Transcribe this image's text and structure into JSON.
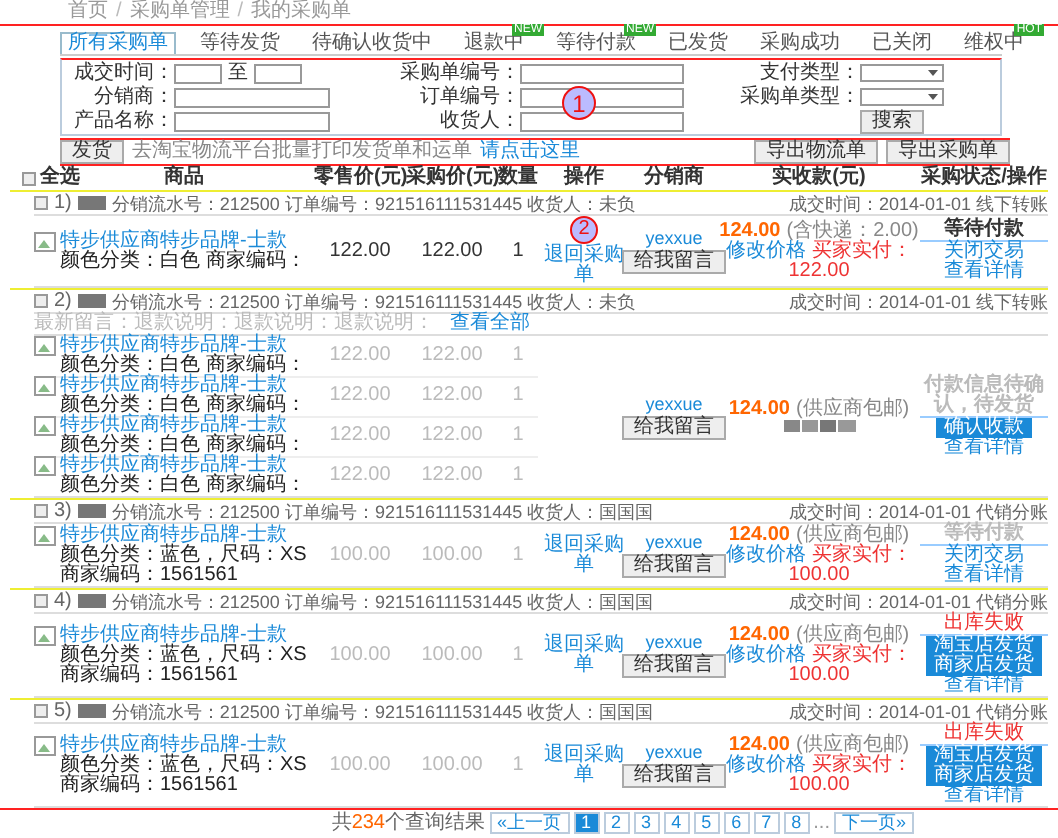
{
  "breadcrumb": {
    "separator": "/",
    "items": [
      "首页",
      "采购单管理",
      "我的采购单"
    ]
  },
  "tabs": [
    {
      "label": "所有采购单",
      "selected": true
    },
    {
      "label": "等待发货",
      "selected": false
    },
    {
      "label": "待确认收货中",
      "selected": false
    },
    {
      "label": "退款中",
      "selected": false,
      "badge": "NEW"
    },
    {
      "label": "等待付款",
      "selected": false,
      "badge": "NEW"
    },
    {
      "label": "已发货",
      "selected": false
    },
    {
      "label": "采购成功",
      "selected": false
    },
    {
      "label": "已关闭",
      "selected": false
    },
    {
      "label": "维权中",
      "selected": false,
      "badge": "HOT"
    }
  ],
  "filter": {
    "marker": "1",
    "date_label": "成交时间：",
    "date_to": "至",
    "distributor_label": "分销商：",
    "product_label": "产品名称：",
    "po_label": "采购单编号：",
    "order_label": "订单编号：",
    "receiver_label": "收货人：",
    "pay_type_label": "支付类型：",
    "po_type_label": "采购单类型：",
    "search_button": "搜索"
  },
  "toolbar": {
    "ship_button": "发货",
    "hint": "去淘宝物流平台批量打印发货单和运单",
    "hint_link": "请点击这里",
    "export_buttons": [
      "导出物流单",
      "导出采购单"
    ]
  },
  "columns": [
    "全选",
    "商品",
    "零售价(元)",
    "采购价(元)",
    "数量",
    "操作",
    "分销商",
    "实收款(元)",
    "采购状态/操作"
  ],
  "select_all_checked": false,
  "orders": [
    {
      "index": "1)",
      "checked": false,
      "info": "分销流水号：212500 订单编号：921516111531445 收货人：未负",
      "time": "成交时间：2014-01-01 线下转账",
      "marker": "2",
      "operation": "退回采购单",
      "distributor": "yexxue",
      "message_button": "给我留言",
      "items": [
        {
          "name": "特步供应商特步品牌-士款",
          "spec": "颜色分类：白色",
          "code": "商家编码：",
          "retail": "122.00",
          "purchase": "122.00",
          "qty": "1"
        }
      ],
      "amount": [
        {
          "kind": "total",
          "text": "124.00"
        },
        {
          "kind": "note",
          "text": "(含快递：2.00)"
        },
        {
          "kind": "link",
          "text": "修改价格"
        },
        {
          "kind": "paid",
          "text": "买家实付："
        },
        {
          "kind": "paid",
          "text": "122.00"
        }
      ],
      "status": [
        {
          "kind": "text",
          "text": "等待付款"
        },
        {
          "kind": "link",
          "text": "关闭交易"
        },
        {
          "kind": "link",
          "text": "查看详情"
        }
      ]
    },
    {
      "index": "2)",
      "checked": false,
      "info": "分销流水号：212500 订单编号：921516111531445 收货人：未负",
      "time": "成交时间：2014-01-01 线下转账",
      "message": "最新留言：退款说明：退款说明：退款说明：",
      "message_link": "查看全部",
      "distributor": "yexxue",
      "message_button": "给我留言",
      "items": [
        {
          "name": "特步供应商特步品牌-士款",
          "spec": "颜色分类：白色",
          "code": "商家编码：",
          "retail": "122.00",
          "purchase": "122.00",
          "qty": "1"
        },
        {
          "name": "特步供应商特步品牌-士款",
          "spec": "颜色分类：白色",
          "code": "商家编码：",
          "retail": "122.00",
          "purchase": "122.00",
          "qty": "1"
        },
        {
          "name": "特步供应商特步品牌-士款",
          "spec": "颜色分类：白色",
          "code": "商家编码：",
          "retail": "122.00",
          "purchase": "122.00",
          "qty": "1"
        },
        {
          "name": "特步供应商特步品牌-士款",
          "spec": "颜色分类：白色",
          "code": "商家编码：",
          "retail": "122.00",
          "purchase": "122.00",
          "qty": "1"
        }
      ],
      "amount": [
        {
          "kind": "total",
          "text": "124.00"
        },
        {
          "kind": "note",
          "text": "(供应商包邮)"
        },
        {
          "kind": "icons"
        }
      ],
      "status": [
        {
          "kind": "text",
          "text": "付款信息待确认，待发货"
        },
        {
          "kind": "button",
          "text": "确认收款"
        },
        {
          "kind": "link",
          "text": "查看详情"
        }
      ]
    },
    {
      "index": "3)",
      "checked": false,
      "info": "分销流水号：212500 订单编号：921516111531445 收货人：国国国",
      "time": "成交时间：2014-01-01 代销分账",
      "operation": "退回采购单",
      "distributor": "yexxue",
      "message_button": "给我留言",
      "items": [
        {
          "name": "特步供应商特步品牌-士款",
          "spec": "颜色分类：蓝色，尺码：XS",
          "code": "商家编码：1561561",
          "retail": "100.00",
          "purchase": "100.00",
          "qty": "1"
        }
      ],
      "amount": [
        {
          "kind": "total",
          "text": "124.00"
        },
        {
          "kind": "note",
          "text": "(供应商包邮)"
        },
        {
          "kind": "link",
          "text": "修改价格"
        },
        {
          "kind": "paid",
          "text": "买家实付："
        },
        {
          "kind": "paid",
          "text": "100.00"
        }
      ],
      "status": [
        {
          "kind": "text",
          "text": "等待付款"
        },
        {
          "kind": "link",
          "text": "关闭交易"
        },
        {
          "kind": "link",
          "text": "查看详情"
        }
      ]
    },
    {
      "index": "4)",
      "checked": false,
      "info": "分销流水号：212500 订单编号：921516111531445 收货人：国国国",
      "time": "成交时间：2014-01-01 代销分账",
      "operation": "退回采购单",
      "distributor": "yexxue",
      "message_button": "给我留言",
      "items": [
        {
          "name": "特步供应商特步品牌-士款",
          "spec": "颜色分类：蓝色，尺码：XS",
          "code": "商家编码：1561561",
          "retail": "100.00",
          "purchase": "100.00",
          "qty": "1"
        }
      ],
      "amount": [
        {
          "kind": "total",
          "text": "124.00"
        },
        {
          "kind": "note",
          "text": "(供应商包邮)"
        },
        {
          "kind": "link",
          "text": "修改价格"
        },
        {
          "kind": "paid",
          "text": "买家实付："
        },
        {
          "kind": "paid",
          "text": "100.00"
        }
      ],
      "status": [
        {
          "kind": "error",
          "text": "出库失败"
        },
        {
          "kind": "button",
          "text": "淘宝店发货"
        },
        {
          "kind": "button",
          "text": "商家店发货"
        },
        {
          "kind": "link",
          "text": "查看详情"
        }
      ]
    },
    {
      "index": "5)",
      "checked": false,
      "info": "分销流水号：212500 订单编号：921516111531445 收货人：国国国",
      "time": "成交时间：2014-01-01 代销分账",
      "operation": "退回采购单",
      "distributor": "yexxue",
      "message_button": "给我留言",
      "items": [
        {
          "name": "特步供应商特步品牌-士款",
          "spec": "颜色分类：蓝色，尺码：XS",
          "code": "商家编码：1561561",
          "retail": "100.00",
          "purchase": "100.00",
          "qty": "1"
        }
      ],
      "amount": [
        {
          "kind": "total",
          "text": "124.00"
        },
        {
          "kind": "note",
          "text": "(供应商包邮)"
        },
        {
          "kind": "link",
          "text": "修改价格"
        },
        {
          "kind": "paid",
          "text": "买家实付："
        },
        {
          "kind": "paid",
          "text": "100.00"
        }
      ],
      "status": [
        {
          "kind": "error",
          "text": "出库失败"
        },
        {
          "kind": "button",
          "text": "淘宝店发货"
        },
        {
          "kind": "button",
          "text": "商家店发货"
        },
        {
          "kind": "link",
          "text": "查看详情"
        }
      ]
    }
  ],
  "pagination": {
    "prefix": "共",
    "count": "234",
    "suffix": "个查询结果",
    "prev": "«上一页",
    "pages": [
      {
        "label": "1",
        "selected": true
      },
      {
        "label": "2",
        "selected": false
      },
      {
        "label": "3",
        "selected": false
      },
      {
        "label": "4",
        "selected": false
      },
      {
        "label": "5",
        "selected": false
      },
      {
        "label": "6",
        "selected": false
      },
      {
        "label": "7",
        "selected": false
      },
      {
        "label": "8",
        "selected": false
      }
    ],
    "ellipsis": "...",
    "next": "下一页»"
  }
}
